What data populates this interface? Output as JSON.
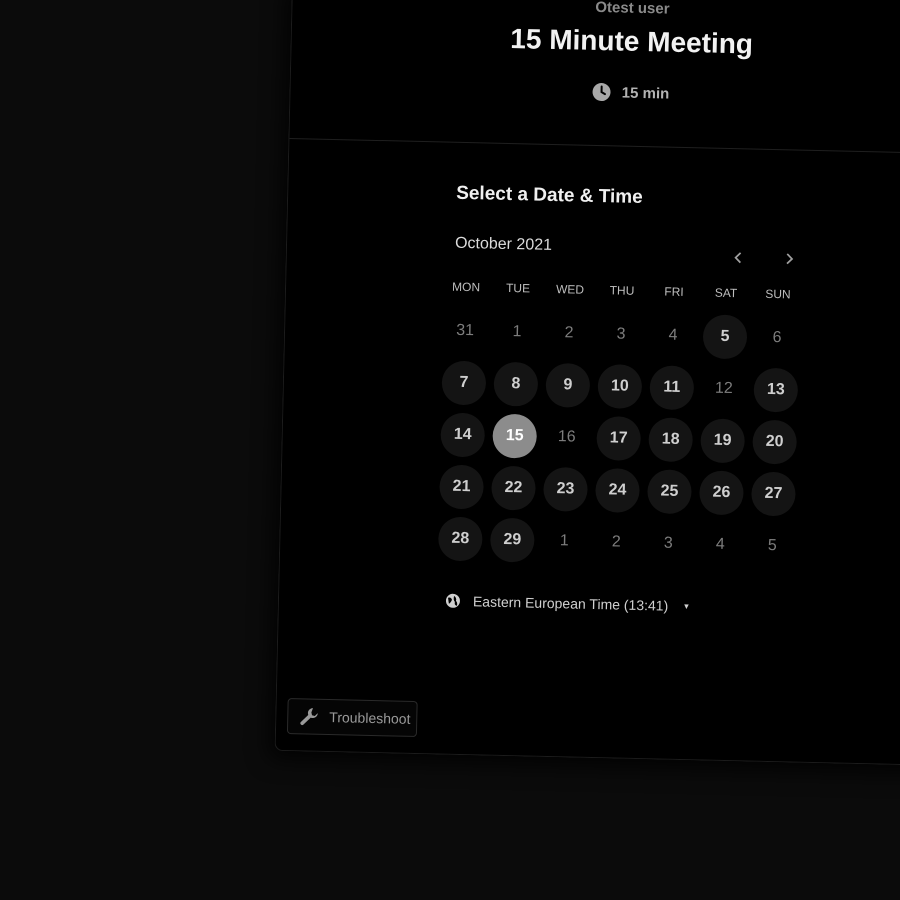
{
  "header": {
    "host_name": "Otest user",
    "event_title": "15 Minute Meeting",
    "duration": "15 min",
    "duration_icon": "clock-icon"
  },
  "calendar": {
    "section_title": "Select a Date & Time",
    "month_label": "October 2021",
    "prev_icon": "chevron-left-icon",
    "next_icon": "chevron-right-icon",
    "weekdays": [
      "MON",
      "TUE",
      "WED",
      "THU",
      "FRI",
      "SAT",
      "SUN"
    ],
    "days": [
      {
        "label": "31",
        "state": "muted"
      },
      {
        "label": "1",
        "state": "muted"
      },
      {
        "label": "2",
        "state": "muted"
      },
      {
        "label": "3",
        "state": "muted"
      },
      {
        "label": "4",
        "state": "muted"
      },
      {
        "label": "5",
        "state": "available"
      },
      {
        "label": "6",
        "state": "muted"
      },
      {
        "label": "7",
        "state": "available"
      },
      {
        "label": "8",
        "state": "available"
      },
      {
        "label": "9",
        "state": "available"
      },
      {
        "label": "10",
        "state": "available"
      },
      {
        "label": "11",
        "state": "available"
      },
      {
        "label": "12",
        "state": "muted"
      },
      {
        "label": "13",
        "state": "available"
      },
      {
        "label": "14",
        "state": "available"
      },
      {
        "label": "15",
        "state": "selected"
      },
      {
        "label": "16",
        "state": "muted"
      },
      {
        "label": "17",
        "state": "available"
      },
      {
        "label": "18",
        "state": "available"
      },
      {
        "label": "19",
        "state": "available"
      },
      {
        "label": "20",
        "state": "available"
      },
      {
        "label": "21",
        "state": "available"
      },
      {
        "label": "22",
        "state": "available"
      },
      {
        "label": "23",
        "state": "available"
      },
      {
        "label": "24",
        "state": "available"
      },
      {
        "label": "25",
        "state": "available"
      },
      {
        "label": "26",
        "state": "available"
      },
      {
        "label": "27",
        "state": "available"
      },
      {
        "label": "28",
        "state": "available"
      },
      {
        "label": "29",
        "state": "available"
      },
      {
        "label": "1",
        "state": "muted"
      },
      {
        "label": "2",
        "state": "muted"
      },
      {
        "label": "3",
        "state": "muted"
      },
      {
        "label": "4",
        "state": "muted"
      },
      {
        "label": "5",
        "state": "muted"
      }
    ]
  },
  "timezone": {
    "icon": "globe-icon",
    "label": "Eastern European Time (13:41)",
    "caret": "▾"
  },
  "troubleshoot": {
    "icon": "wrench-icon",
    "label": "Troubleshoot"
  },
  "colors": {
    "background": "#000000",
    "available_day_bg": "#141414",
    "selected_day_bg": "#8c8c8c",
    "muted_text": "#7d7d7d"
  }
}
